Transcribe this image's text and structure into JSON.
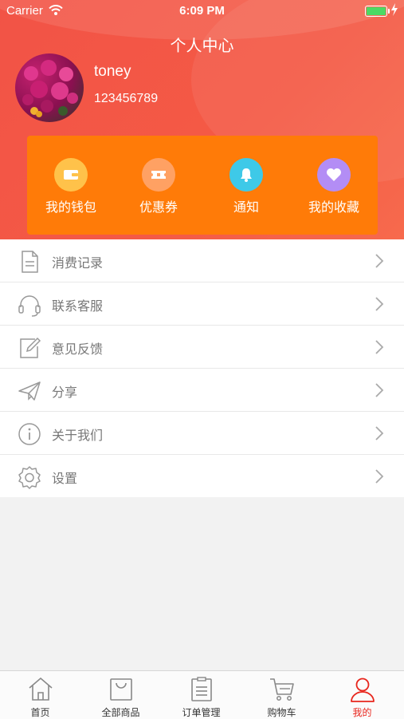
{
  "status_bar": {
    "carrier": "Carrier",
    "time": "6:09 PM"
  },
  "header": {
    "title": "个人中心"
  },
  "profile": {
    "username": "toney",
    "phone": "123456789",
    "avatar_icon": "flower-photo-avatar"
  },
  "quick_actions": [
    {
      "label": "我的钱包",
      "icon": "wallet-icon",
      "color": "#ffc24a"
    },
    {
      "label": "优惠券",
      "icon": "ticket-icon",
      "color": "#ffa163"
    },
    {
      "label": "通知",
      "icon": "bell-icon",
      "color": "#3ec9e8"
    },
    {
      "label": "我的收藏",
      "icon": "heart-icon",
      "color": "#b38df5"
    }
  ],
  "menu": [
    {
      "label": "消费记录",
      "icon": "document-icon"
    },
    {
      "label": "联系客服",
      "icon": "headset-icon"
    },
    {
      "label": "意见反馈",
      "icon": "edit-icon"
    },
    {
      "label": "分享",
      "icon": "paper-plane-icon"
    },
    {
      "label": "关于我们",
      "icon": "info-icon"
    },
    {
      "label": "设置",
      "icon": "settings-gear-icon"
    }
  ],
  "tabs": [
    {
      "label": "首页",
      "icon": "home-icon",
      "active": false
    },
    {
      "label": "全部商品",
      "icon": "shopping-bag-icon",
      "active": false
    },
    {
      "label": "订单管理",
      "icon": "order-list-icon",
      "active": false
    },
    {
      "label": "购物车",
      "icon": "cart-icon",
      "active": false
    },
    {
      "label": "我的",
      "icon": "user-icon",
      "active": true
    }
  ],
  "colors": {
    "header_red": "#f45a45",
    "quick_panel_orange": "#ff7b08",
    "active_tab": "#e8261d"
  }
}
